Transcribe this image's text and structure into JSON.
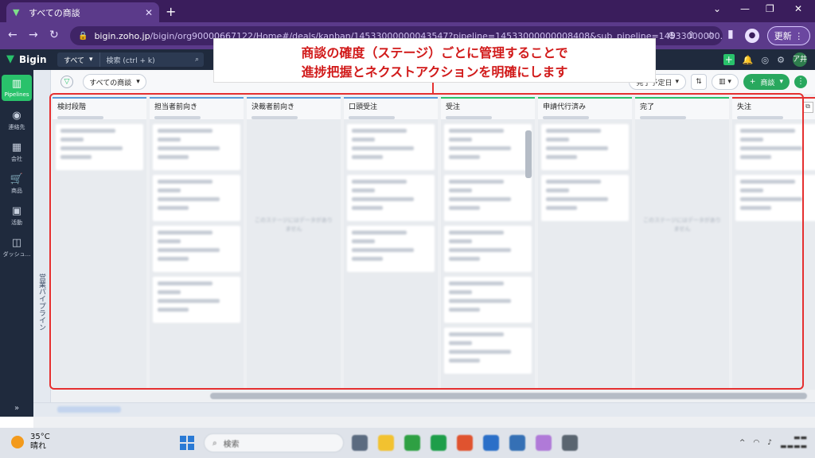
{
  "browser": {
    "tab_title": "すべての商談",
    "tab_close": "✕",
    "new_tab": "+",
    "url_host": "bigin.zoho.jp",
    "url_path": "/bigin/org90000667122/Home#/deals/kanban/14533000000043547?pipeline=14533000000008408&sub_pipeline=14533000000...",
    "update_label": "更新",
    "profile_initial": "●"
  },
  "app": {
    "name": "Bigin",
    "search_scope": "すべて",
    "search_placeholder": "検索 (ctrl + k)",
    "avatar_text": "ア井"
  },
  "leftnav": {
    "items": [
      {
        "label": "Pipelines",
        "icon": "pipelines-icon"
      },
      {
        "label": "連絡先",
        "icon": "contacts-icon"
      },
      {
        "label": "会社",
        "icon": "company-icon"
      },
      {
        "label": "商品",
        "icon": "cart-icon"
      },
      {
        "label": "活動",
        "icon": "calendar-icon"
      },
      {
        "label": "ダッシュ...",
        "icon": "dashboard-icon"
      }
    ],
    "pipeline_panel_label": "営業パイプライン"
  },
  "toolbar": {
    "view_label": "すべての商談",
    "sort_label": "完了予定日",
    "new_deal_label": "商談"
  },
  "board": {
    "columns": [
      {
        "name": "検討段階",
        "cards": 1,
        "empty": false
      },
      {
        "name": "担当者前向き",
        "cards": 4,
        "empty": false
      },
      {
        "name": "決裁者前向き",
        "cards": 0,
        "empty": true
      },
      {
        "name": "口頭受注",
        "cards": 3,
        "empty": false
      },
      {
        "name": "受注",
        "cards": 5,
        "empty": false
      },
      {
        "name": "申請代行済み",
        "cards": 2,
        "empty": false
      },
      {
        "name": "完了",
        "cards": 0,
        "empty": true
      },
      {
        "name": "失注",
        "cards": 2,
        "empty": false
      }
    ],
    "empty_message": "このステージにはデータがありません"
  },
  "annotation": {
    "line1": "商談の確度（ステージ）ごとに管理することで",
    "line2": "進捗把握とネクストアクションを明確にします"
  },
  "taskbar": {
    "temperature": "35°C",
    "weather": "晴れ",
    "search_placeholder": "検索"
  },
  "colors": {
    "accent_green": "#29c26b",
    "annotation_red": "#e53030",
    "browser_purple": "#5b3a8a"
  }
}
